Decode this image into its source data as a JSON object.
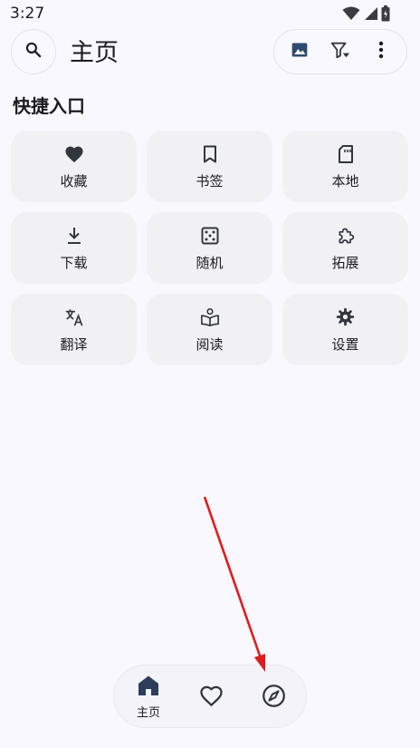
{
  "status_bar": {
    "time": "3:27"
  },
  "header": {
    "title": "主页",
    "search_icon": "search-icon",
    "actions": [
      {
        "name": "image-icon"
      },
      {
        "name": "filter-icon"
      },
      {
        "name": "more-vert-icon"
      }
    ]
  },
  "quick_access": {
    "title": "快捷入口",
    "items": [
      {
        "label": "收藏",
        "icon": "heart-icon"
      },
      {
        "label": "书签",
        "icon": "bookmark-icon"
      },
      {
        "label": "本地",
        "icon": "sd-card-icon"
      },
      {
        "label": "下载",
        "icon": "download-icon"
      },
      {
        "label": "随机",
        "icon": "dice-icon"
      },
      {
        "label": "拓展",
        "icon": "extension-icon"
      },
      {
        "label": "翻译",
        "icon": "translate-icon"
      },
      {
        "label": "阅读",
        "icon": "reading-icon"
      },
      {
        "label": "设置",
        "icon": "gear-icon"
      }
    ]
  },
  "bottom_nav": {
    "items": [
      {
        "label": "主页",
        "icon": "home-icon",
        "selected": true
      },
      {
        "label": "",
        "icon": "heart-outline-icon",
        "selected": false
      },
      {
        "label": "",
        "icon": "compass-icon",
        "selected": false
      }
    ]
  },
  "colors": {
    "background": "#f9f8ff",
    "tile": "#f1f1f4",
    "icon": "#32363d",
    "accent_image": "#2f4a6e",
    "annotation_arrow": "#e01b1b"
  }
}
